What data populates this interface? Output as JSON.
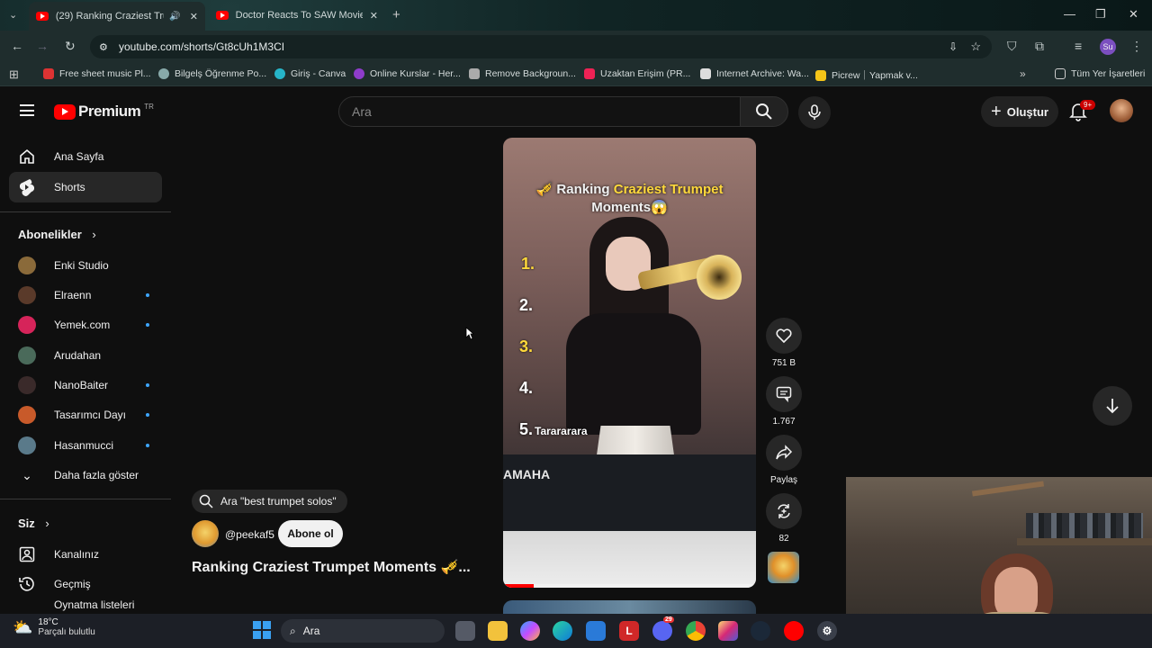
{
  "browser": {
    "tabs": [
      {
        "title": "(29) Ranking Craziest Trump"
      },
      {
        "title": "Doctor Reacts To SAW Movie"
      }
    ],
    "url": "youtube.com/shorts/Gt8cUh1M3CI",
    "profile_initials": "Su",
    "bookmarks": [
      "Free sheet music Pl...",
      "Bilgelş Öğrenme Po...",
      "Giriş - Canva",
      "Online Kurslar - Her...",
      "Remove Backgroun...",
      "Uzaktan Erişim (PR...",
      "Internet Archive: Wa...",
      "Picrew｜Yapmak v..."
    ],
    "all_bookmarks": "Tüm Yer İşaretleri"
  },
  "youtube": {
    "logo_text": "Premium",
    "logo_region": "TR",
    "search_placeholder": "Ara",
    "create_label": "Oluştur",
    "notif_badge": "9+"
  },
  "sidebar": {
    "home": "Ana Sayfa",
    "shorts": "Shorts",
    "subscriptions_heading": "Abonelikler",
    "channels": [
      {
        "name": "Enki Studio",
        "new": false,
        "color": "#8a6a3a"
      },
      {
        "name": "Elraenn",
        "new": true,
        "color": "#5a3a2a"
      },
      {
        "name": "Yemek.com",
        "new": true,
        "color": "#d6245a"
      },
      {
        "name": "Arudahan",
        "new": false,
        "color": "#4a6a5a"
      },
      {
        "name": "NanoBaiter",
        "new": true,
        "color": "#3a2a2a"
      },
      {
        "name": "Tasarımcı Dayı",
        "new": true,
        "color": "#c85a2a"
      },
      {
        "name": "Hasanmucci",
        "new": true,
        "color": "#5a7a8a"
      }
    ],
    "show_more": "Daha fazla göster",
    "you_heading": "Siz",
    "your_channel": "Kanalınız",
    "history": "Geçmiş",
    "partial_item": "Oynatma listeleri"
  },
  "short": {
    "search_chip": "Ara \"best trumpet solos\"",
    "channel": "@peekaf5",
    "subscribe": "Abone ol",
    "title": "Ranking Craziest Trumpet Moments 🎺...",
    "overlay_title_1": "Ranking",
    "overlay_title_highlight": "Craziest Trumpet",
    "overlay_title_2": "Moments😱",
    "ranks": [
      "1.",
      "2.",
      "3.",
      "4.",
      "5."
    ],
    "rank5_text": "Tarararara",
    "keyboard_brand": "AMAHA",
    "likes": "751 B",
    "comments": "1.767",
    "share": "Paylaş",
    "remix": "82",
    "progress": 0.12
  },
  "taskbar": {
    "temp": "18°C",
    "weather": "Parçalı bulutlu",
    "search": "Ara",
    "discord_badge": "29"
  }
}
